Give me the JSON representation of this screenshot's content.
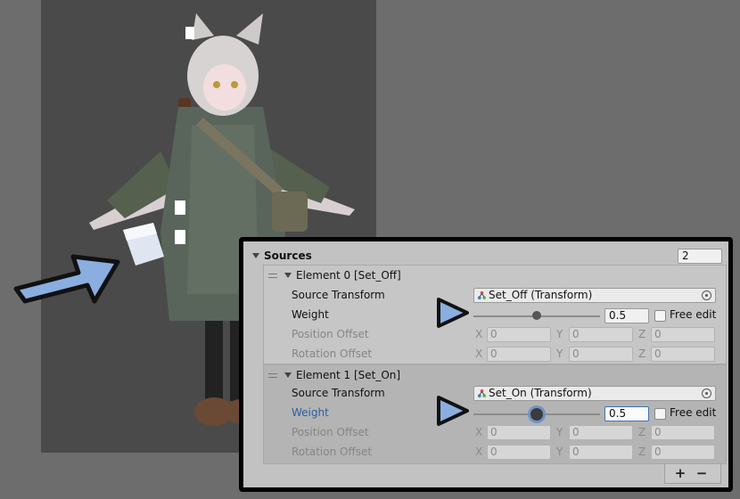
{
  "sources": {
    "title": "Sources",
    "size": "2"
  },
  "elements": [
    {
      "header": "Element 0 [Set_Off]",
      "source_transform_label": "Source Transform",
      "source_transform_value": "Set_Off (Transform)",
      "weight_label": "Weight",
      "weight_value": "0.5",
      "weight_fraction": 0.5,
      "free_edit_label": "Free edit",
      "position_offset_label": "Position Offset",
      "rotation_offset_label": "Rotation Offset",
      "position": {
        "x": "0",
        "y": "0",
        "z": "0"
      },
      "rotation": {
        "x": "0",
        "y": "0",
        "z": "0"
      }
    },
    {
      "header": "Element 1 [Set_On]",
      "source_transform_label": "Source Transform",
      "source_transform_value": "Set_On (Transform)",
      "weight_label": "Weight",
      "weight_value": "0.5",
      "weight_fraction": 0.5,
      "free_edit_label": "Free edit",
      "position_offset_label": "Position Offset",
      "rotation_offset_label": "Rotation Offset",
      "position": {
        "x": "0",
        "y": "0",
        "z": "0"
      },
      "rotation": {
        "x": "0",
        "y": "0",
        "z": "0"
      }
    }
  ],
  "axes": {
    "x": "X",
    "y": "Y",
    "z": "Z"
  },
  "footer": {
    "add": "+",
    "remove": "−"
  },
  "colors": {
    "annotation_arrow": "#8aaee0",
    "focus": "#3a72b8",
    "viewport": "#4a4a4a"
  }
}
